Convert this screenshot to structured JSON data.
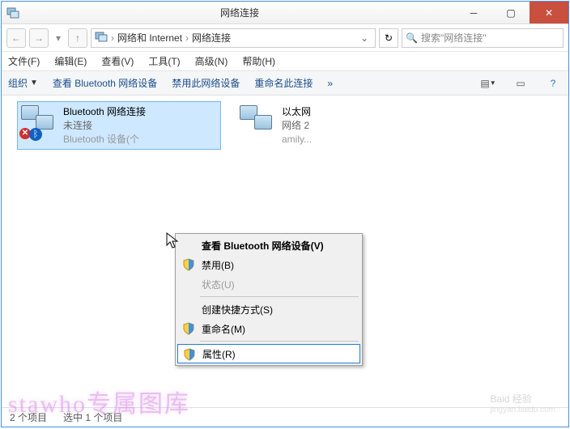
{
  "window": {
    "title": "网络连接"
  },
  "nav": {
    "crumb1": "网络和 Internet",
    "crumb2": "网络连接",
    "search_placeholder": "搜索\"网络连接\""
  },
  "menu": {
    "file": "文件(F)",
    "edit": "编辑(E)",
    "view": "查看(V)",
    "tools": "工具(T)",
    "advanced": "高级(N)",
    "help": "帮助(H)"
  },
  "toolbar": {
    "org": "组织",
    "view_bt": "查看 Bluetooth 网络设备",
    "disable": "禁用此网络设备",
    "rename": "重命名此连接",
    "more": "»"
  },
  "items": [
    {
      "name": "Bluetooth 网络连接",
      "line2": "未连接",
      "line3": "Bluetooth 设备(个"
    },
    {
      "name": "以太网",
      "line2": "网络  2",
      "line3": "amily..."
    }
  ],
  "context": {
    "view_bt": "查看 Bluetooth 网络设备(V)",
    "disable": "禁用(B)",
    "status": "状态(U)",
    "shortcut": "创建快捷方式(S)",
    "rename": "重命名(M)",
    "props": "属性(R)"
  },
  "status": {
    "count": "2 个项目",
    "sel": "选中 1 个项目"
  },
  "watermark": "stawho专属图库",
  "wm2": {
    "main": "Baid 经验",
    "sub": "jingyan.baidu.com"
  }
}
